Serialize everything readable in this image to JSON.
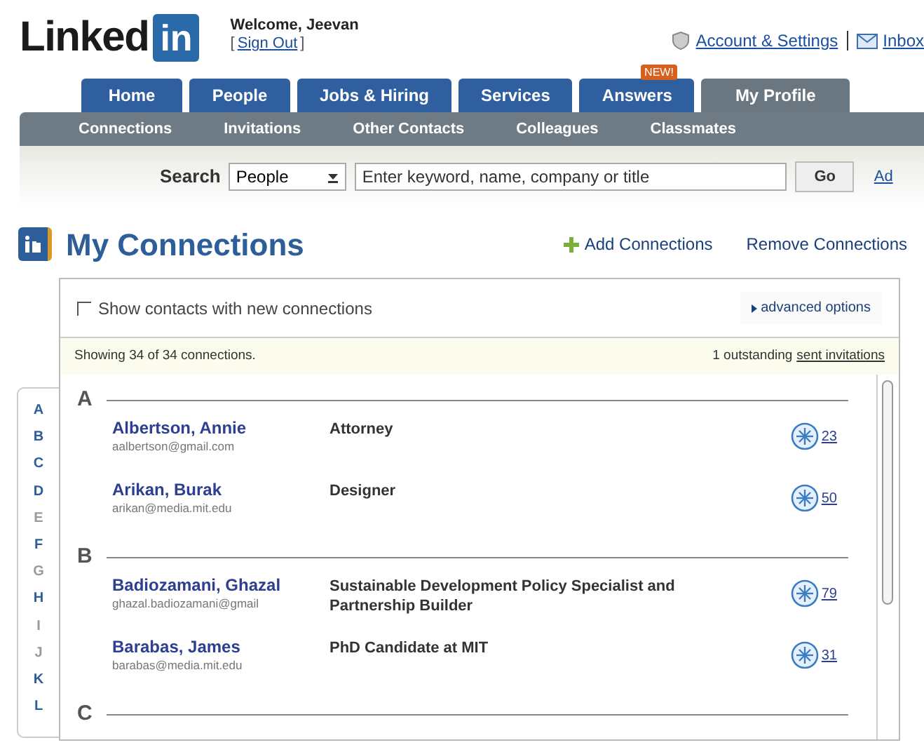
{
  "header": {
    "logo_text": "Linked",
    "logo_badge": "in",
    "welcome": "Welcome, Jeevan",
    "sign_out_open": "[",
    "sign_out": "Sign Out",
    "sign_out_close": "]",
    "account_link": "Account & Settings",
    "inbox_link": "Inbox"
  },
  "tabs": [
    {
      "label": "Home",
      "selected": false
    },
    {
      "label": "People",
      "selected": false
    },
    {
      "label": "Jobs & Hiring",
      "selected": false
    },
    {
      "label": "Services",
      "selected": false
    },
    {
      "label": "Answers",
      "selected": false,
      "badge": "NEW!"
    },
    {
      "label": "My Profile",
      "selected": true
    }
  ],
  "subnav": [
    "Connections",
    "Invitations",
    "Other Contacts",
    "Colleagues",
    "Classmates"
  ],
  "search": {
    "label": "Search",
    "scope": "People",
    "placeholder": "Enter keyword, name, company or title",
    "button": "Go",
    "advanced": "Ad"
  },
  "page_title": "My Connections",
  "actions": {
    "add": "Add Connections",
    "remove": "Remove Connections"
  },
  "filter": {
    "label": "Show contacts with new connections",
    "checked": false,
    "advanced": "advanced options"
  },
  "summary": {
    "showing": "Showing 34 of 34 connections.",
    "outstanding": "1 outstanding",
    "link": "sent invitations"
  },
  "alphabet": [
    {
      "letter": "A",
      "disabled": false
    },
    {
      "letter": "B",
      "disabled": false
    },
    {
      "letter": "C",
      "disabled": false
    },
    {
      "letter": "D",
      "disabled": false
    },
    {
      "letter": "E",
      "disabled": true
    },
    {
      "letter": "F",
      "disabled": false
    },
    {
      "letter": "G",
      "disabled": true
    },
    {
      "letter": "H",
      "disabled": false
    },
    {
      "letter": "I",
      "disabled": true
    },
    {
      "letter": "J",
      "disabled": true
    },
    {
      "letter": "K",
      "disabled": false
    },
    {
      "letter": "L",
      "disabled": false
    }
  ],
  "groups": [
    {
      "letter": "A",
      "contacts": [
        {
          "name": "Albertson, Annie",
          "email": "aalbertson@gmail.com",
          "title": "Attorney",
          "count": "23"
        },
        {
          "name": "Arikan, Burak",
          "email": "arikan@media.mit.edu",
          "title": "Designer",
          "count": "50"
        }
      ]
    },
    {
      "letter": "B",
      "contacts": [
        {
          "name": "Badiozamani, Ghazal",
          "email": "ghazal.badiozamani@gmail",
          "title": "Sustainable Development Policy Specialist and Partnership Builder",
          "count": "79"
        },
        {
          "name": "Barabas, James",
          "email": "barabas@media.mit.edu",
          "title": "PhD Candidate at MIT",
          "count": "31"
        }
      ]
    },
    {
      "letter": "C"
    }
  ]
}
